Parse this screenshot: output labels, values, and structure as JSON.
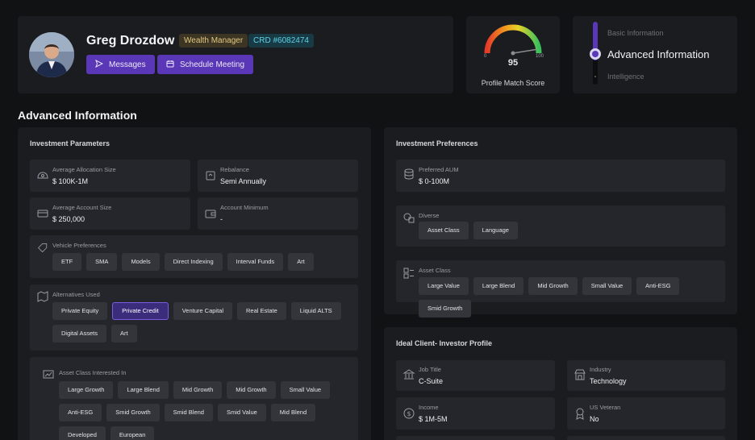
{
  "profile": {
    "name": "Greg Drozdow",
    "role_badge": "Wealth Manager",
    "crd_badge": "CRD #6082474",
    "messages_label": "Messages",
    "schedule_label": "Schedule Meeting"
  },
  "score": {
    "value": "95",
    "value_fraction": 0.95,
    "min_label": "0",
    "max_label": "100",
    "label": "Profile Match Score"
  },
  "steps": {
    "items": [
      "Basic Information",
      "Advanced Information",
      "Intelligence"
    ],
    "active_index": 1
  },
  "section_title": "Advanced Information",
  "investment_parameters": {
    "title": "Investment Parameters",
    "avg_allocation": {
      "label": "Average Allocation Size",
      "value": "$ 100K-1M"
    },
    "rebalance": {
      "label": "Rebalance",
      "value": "Semi Annually"
    },
    "avg_account": {
      "label": "Average Account Size",
      "value": "$ 250,000"
    },
    "account_min": {
      "label": "Account Minimum",
      "value": "-"
    },
    "vehicle": {
      "label": "Vehicle Preferences",
      "chips": [
        "ETF",
        "SMA",
        "Models",
        "Direct Indexing",
        "Interval Funds",
        "Art"
      ]
    },
    "alternatives": {
      "label": "Alternatives Used",
      "chips": [
        "Private Equity",
        "Private Credit",
        "Venture Capital",
        "Real Estate",
        "Liquid ALTS",
        "Digital Assets",
        "Art"
      ],
      "active": "Private Credit"
    },
    "asset_class_interest": {
      "label": "Asset Class Interested In",
      "chips": [
        "Large Growth",
        "Large Blend",
        "Mid Growth",
        "Mid Growth",
        "Small Value",
        "Anti-ESG",
        "Smid Growth",
        "Smid Blend",
        "Smid Value",
        "Mid Blend",
        "Developed",
        "European"
      ]
    }
  },
  "investment_preferences": {
    "title": "Investment Preferences",
    "aum": {
      "label": "Preferred AUM",
      "value": "$ 0-100M"
    },
    "diverse": {
      "label": "Diverse",
      "chips": [
        "Asset Class",
        "Language"
      ]
    },
    "asset_class": {
      "label": "Asset Class",
      "chips": [
        "Large Value",
        "Large Blend",
        "Mid Growth",
        "Small Value",
        "Anti-ESG",
        "Smid Growth"
      ]
    }
  },
  "ideal_client": {
    "title": "Ideal Client- Investor Profile",
    "job": {
      "label": "Job Title",
      "value": "C-Suite"
    },
    "industry": {
      "label": "Industry",
      "value": "Technology"
    },
    "income": {
      "label": "Income",
      "value": "$ 1M-5M"
    },
    "veteran": {
      "label": "US Veteran",
      "value": "No"
    }
  },
  "colors": {
    "accent": "#5a37b6",
    "badge_role": "#e2c982",
    "badge_crd": "#5fd3e8"
  }
}
